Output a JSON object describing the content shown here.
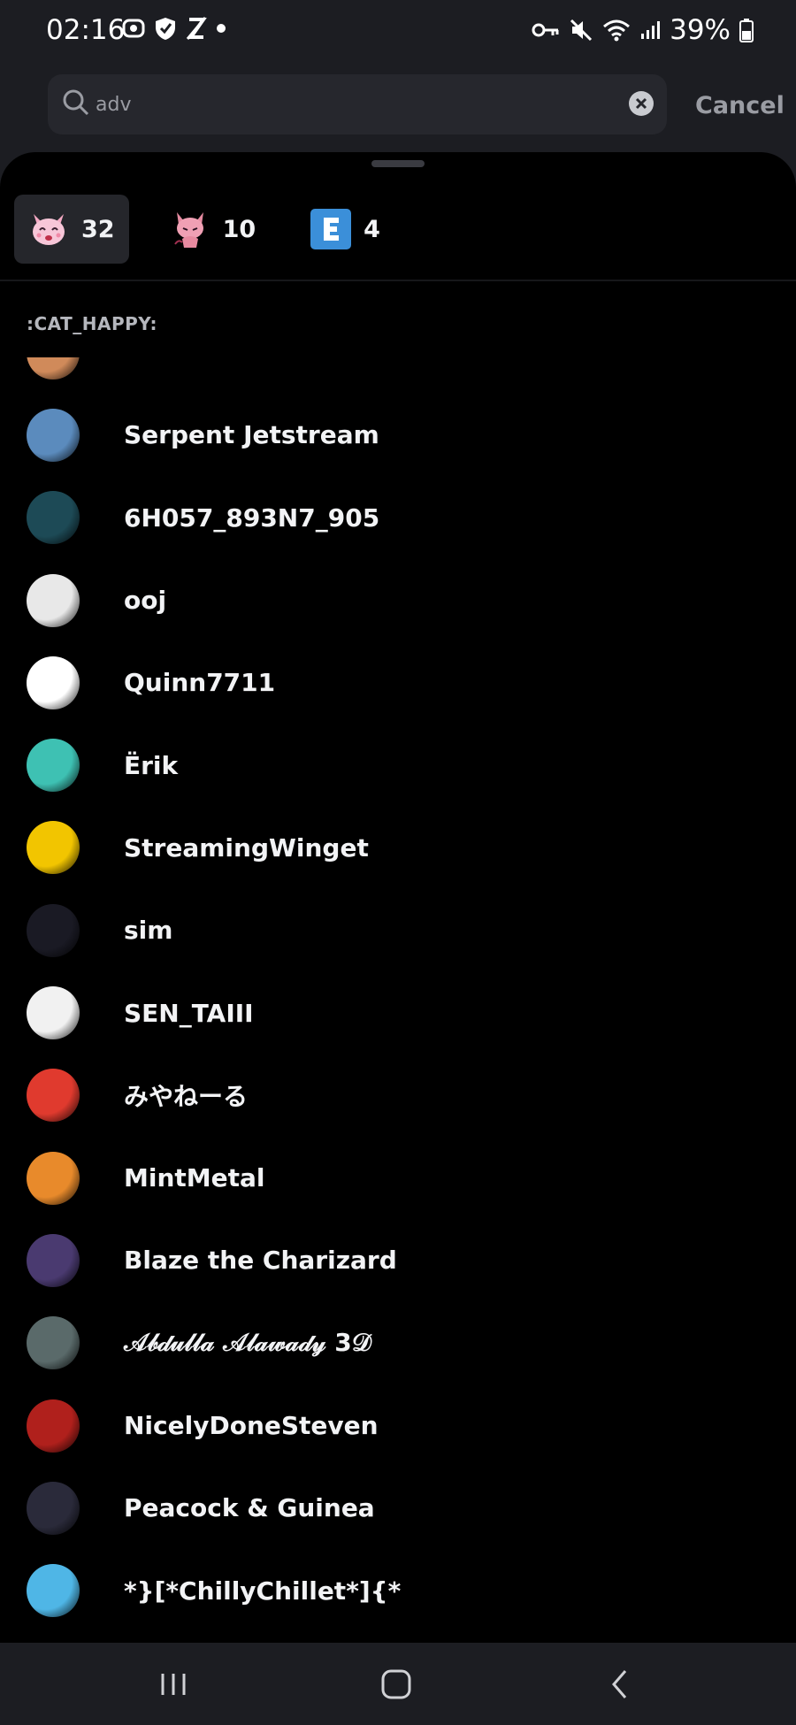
{
  "status_bar": {
    "time": "02:16",
    "battery": "39%",
    "left_icons": [
      "record-icon",
      "shield-icon",
      "no-sync-icon",
      "dot-icon"
    ],
    "right_icons": [
      "key-icon",
      "mute-icon",
      "wifi-icon",
      "signal-icon",
      "battery-icon"
    ]
  },
  "search": {
    "value": "adv",
    "cancel_label": "Cancel"
  },
  "reaction_tabs": [
    {
      "emoji": "cat-happy-emoji",
      "count": "32",
      "selected": true
    },
    {
      "emoji": "cat-devil-emoji",
      "count": "10",
      "selected": false
    },
    {
      "emoji": "letter-e-emoji",
      "count": "4",
      "selected": false
    }
  ],
  "section": {
    "label": ":CAT_HAPPY:"
  },
  "users": [
    {
      "name": "",
      "avatar": "#d08a5a"
    },
    {
      "name": "Serpent Jetstream",
      "avatar": "#5b8bbd"
    },
    {
      "name": "6H057_893N7_905",
      "avatar": "#1d4a56"
    },
    {
      "name": "ooj",
      "avatar": "#e8e8e8"
    },
    {
      "name": "Quinn7711",
      "avatar": "#ffffff"
    },
    {
      "name": "Ërik",
      "avatar": "#3ec1b3"
    },
    {
      "name": "StreamingWinget",
      "avatar": "#f2c500"
    },
    {
      "name": "sim",
      "avatar": "#1a1a24"
    },
    {
      "name": "SEN_TAIII",
      "avatar": "#f1f1f1"
    },
    {
      "name": "みやねーる",
      "avatar": "#e03a2e"
    },
    {
      "name": "MintMetal",
      "avatar": "#e88a2b"
    },
    {
      "name": "Blaze the Charizard",
      "avatar": "#4a3a70"
    },
    {
      "name": "𝒜𝒷𝒹𝓊𝓁𝓁𝒶 𝒜𝓁𝒶𝓌𝒶𝒹𝓎 3𝒟",
      "avatar": "#5a6a6a"
    },
    {
      "name": "NicelyDoneSteven",
      "avatar": "#b0201c"
    },
    {
      "name": "Peacock & Guinea",
      "avatar": "#2a2a3a"
    },
    {
      "name": "*}[*ChillyChillet*]{*",
      "avatar": "#4fb6e6"
    }
  ],
  "nav_bar": {
    "buttons": [
      "recent-apps-icon",
      "home-icon",
      "back-icon"
    ]
  }
}
